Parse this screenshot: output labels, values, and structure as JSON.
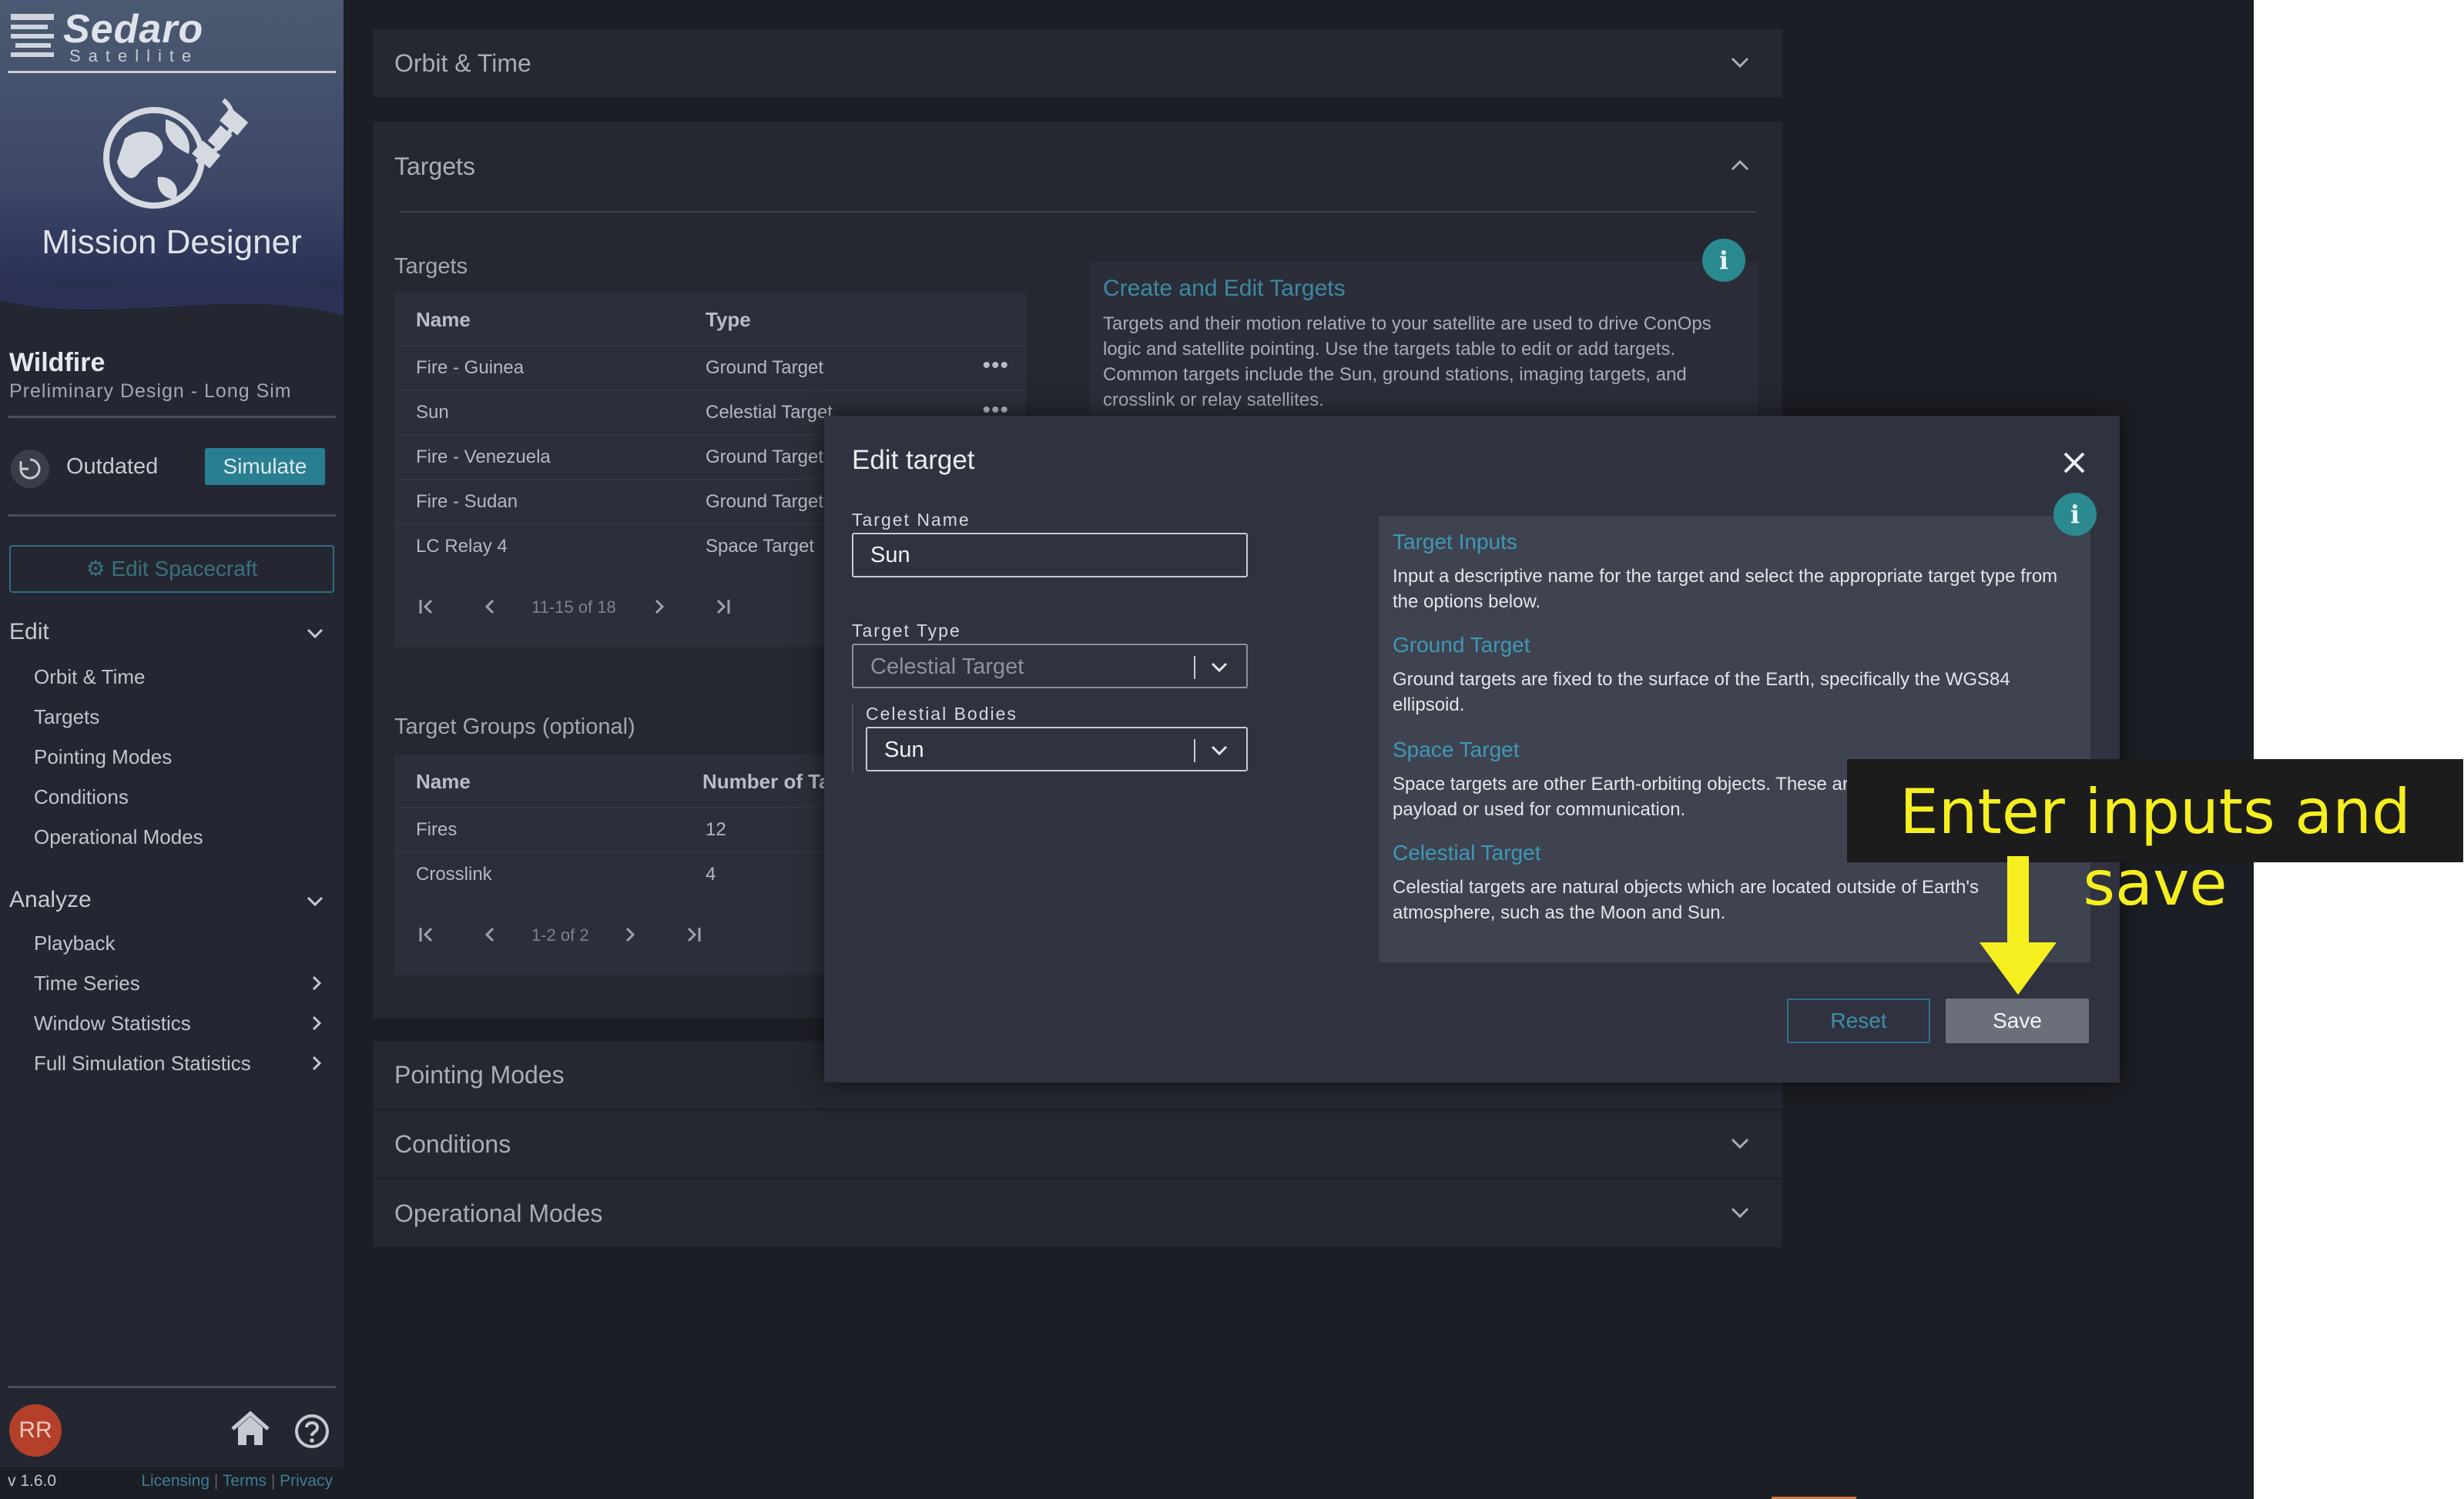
{
  "app": {
    "logo_name": "Sedaro",
    "logo_sub": "Satellite",
    "title": "Mission Designer",
    "project_title": "Wildfire",
    "project_sub": "Preliminary Design - Long Sim",
    "status_text": "Outdated",
    "simulate_label": "Simulate",
    "edit_spacecraft_label": "Edit Spacecraft"
  },
  "sidebar": {
    "edit_header": "Edit",
    "edit_items": [
      "Orbit & Time",
      "Targets",
      "Pointing Modes",
      "Conditions",
      "Operational Modes"
    ],
    "analyze_header": "Analyze",
    "analyze_items": [
      "Playback",
      "Time Series",
      "Window Statistics",
      "Full Simulation Statistics"
    ],
    "avatar_initials": "RR",
    "version": "v 1.6.0",
    "footer_links": [
      "Licensing",
      "Terms",
      "Privacy"
    ]
  },
  "panels": {
    "orbit_time": "Orbit & Time",
    "targets": "Targets",
    "pointing_modes": "Pointing Modes",
    "conditions": "Conditions",
    "operational_modes": "Operational Modes"
  },
  "targets_table": {
    "label": "Targets",
    "columns": [
      "Name",
      "Type"
    ],
    "rows": [
      {
        "name": "Fire - Guinea",
        "type": "Ground Target"
      },
      {
        "name": "Sun",
        "type": "Celestial Target"
      },
      {
        "name": "Fire - Venezuela",
        "type": "Ground Target"
      },
      {
        "name": "Fire - Sudan",
        "type": "Ground Target"
      },
      {
        "name": "LC Relay 4",
        "type": "Space Target"
      }
    ],
    "pager": "11-15 of 18"
  },
  "groups_table": {
    "label": "Target Groups (optional)",
    "columns": [
      "Name",
      "Number of Targets"
    ],
    "rows": [
      {
        "name": "Fires",
        "count": "12"
      },
      {
        "name": "Crosslink",
        "count": "4"
      }
    ],
    "pager": "1-2 of 2"
  },
  "targets_info": {
    "title": "Create and Edit Targets",
    "body": "Targets and their motion relative to your satellite are used to drive ConOps logic and satellite pointing. Use the targets table to edit or add targets. Common targets include the Sun, ground stations, imaging targets, and crosslink or relay satellites."
  },
  "modal": {
    "title": "Edit target",
    "target_name_label": "Target Name",
    "target_name_value": "Sun",
    "target_type_label": "Target Type",
    "target_type_value": "Celestial Target",
    "celestial_bodies_label": "Celestial Bodies",
    "celestial_bodies_value": "Sun",
    "reset_label": "Reset",
    "save_label": "Save",
    "info": {
      "title": "Target Inputs",
      "intro": "Input a descriptive name for the target and select the appropriate target type from the options below.",
      "ground_title": "Ground Target",
      "ground_body": "Ground targets are fixed to the surface of the Earth, specifically the WGS84 ellipsoid.",
      "space_title": "Space Target",
      "space_body": "Space targets are other Earth-orbiting objects. These are typically targeted by your payload or used for communication.",
      "celestial_title": "Celestial Target",
      "celestial_body": "Celestial targets are natural objects which are located outside of Earth's atmosphere, such as the Moon and Sun."
    }
  },
  "callout": {
    "text": "Enter inputs and save",
    "color": "#f6ef20"
  },
  "icons": {
    "info": "i"
  }
}
